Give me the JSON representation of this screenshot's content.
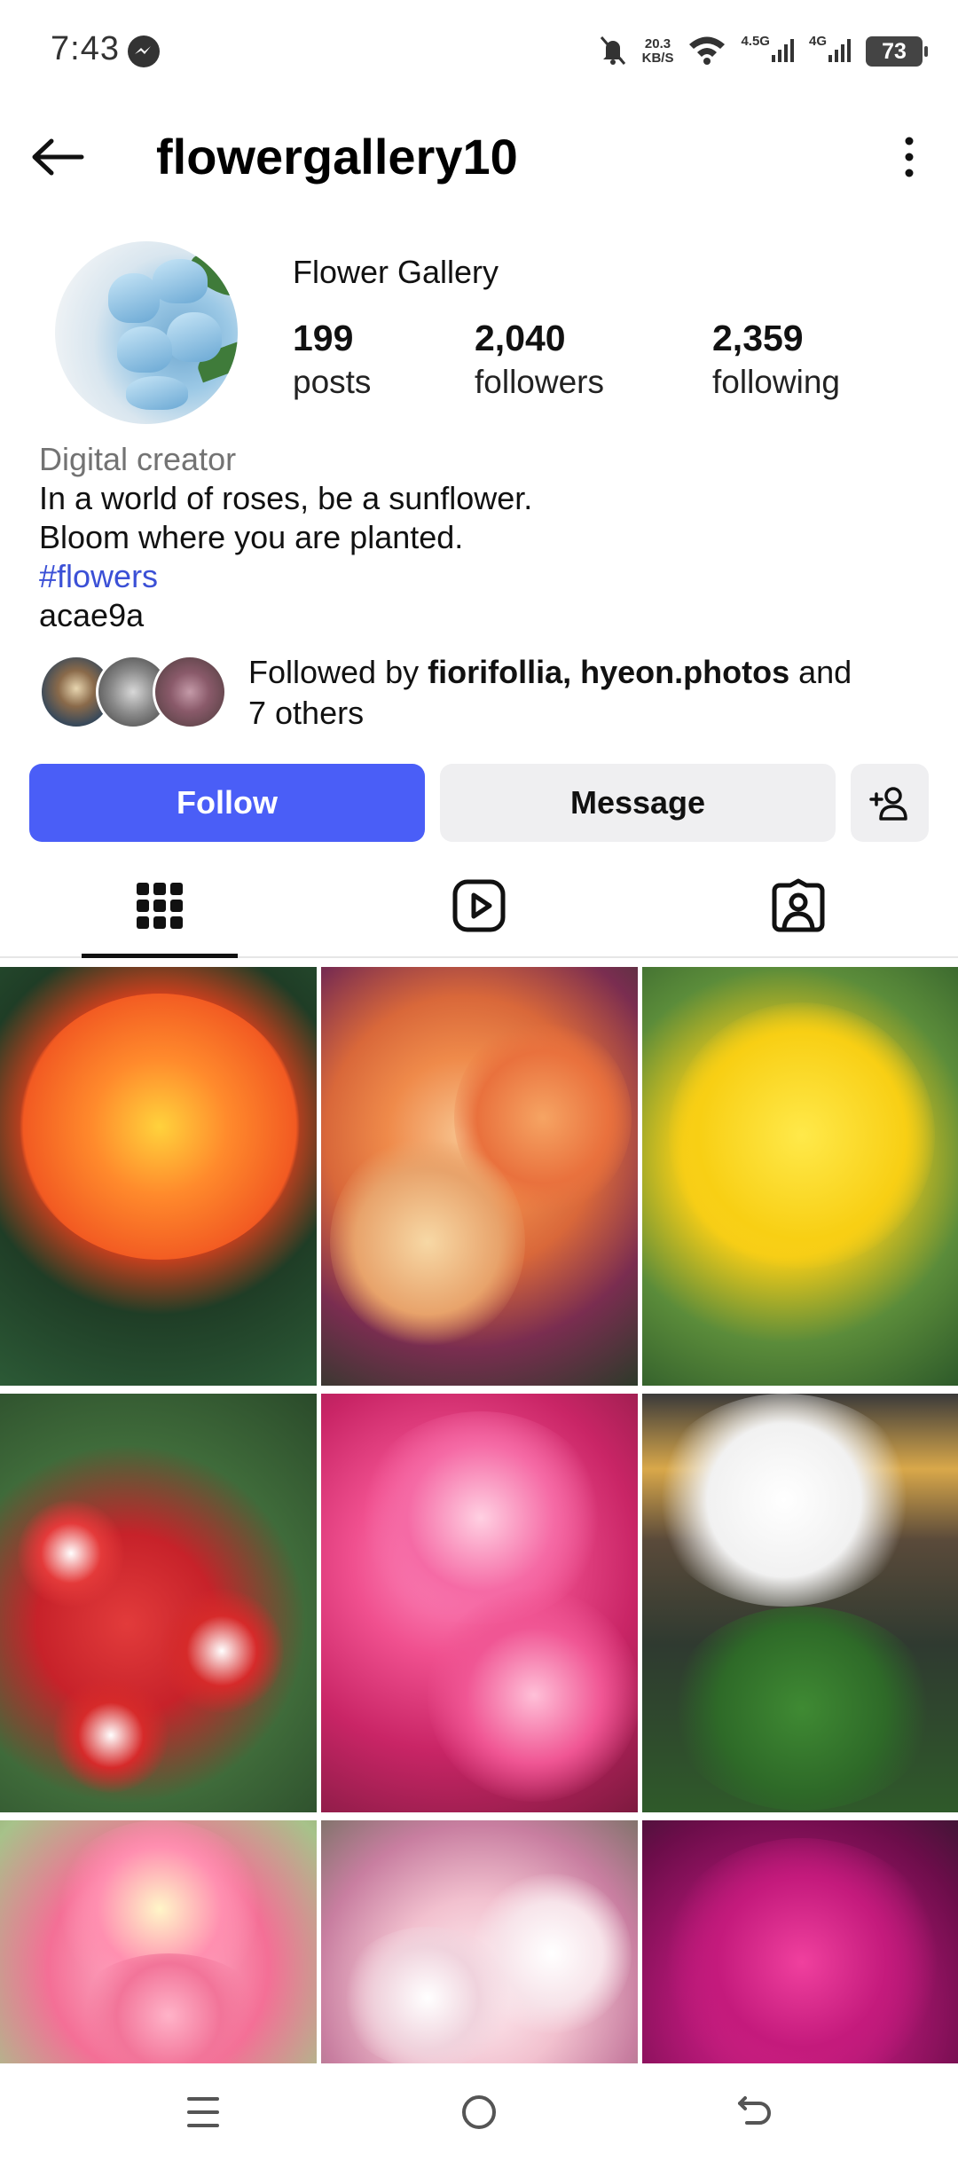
{
  "status_bar": {
    "time": "7:43",
    "net_speed_value": "20.3",
    "net_speed_unit": "KB/S",
    "signal1_label": "4.5G",
    "signal2_label": "4G",
    "battery": "73"
  },
  "header": {
    "username": "flowergallery10"
  },
  "profile": {
    "display_name": "Flower Gallery",
    "stats": {
      "posts": {
        "value": "199",
        "label": "posts"
      },
      "followers": {
        "value": "2,040",
        "label": "followers"
      },
      "following": {
        "value": "2,359",
        "label": "following"
      }
    },
    "category": "Digital creator",
    "bio_line1": "In a world of roses, be a sunflower.",
    "bio_line2": "Bloom where you are planted.",
    "hashtag": "#flowers",
    "extra_line": "acae9a",
    "followed_by": {
      "prefix": "Followed by ",
      "user1": "fiorifollia",
      "separator": ", ",
      "user2": "hyeon.photos",
      "suffix": " and",
      "others": "7 others"
    }
  },
  "buttons": {
    "follow": "Follow",
    "message": "Message"
  },
  "tabs": [
    {
      "icon": "grid-icon",
      "active": true
    },
    {
      "icon": "reels-icon",
      "active": false
    },
    {
      "icon": "tagged-icon",
      "active": false
    }
  ],
  "colors": {
    "accent": "#4a5ef7",
    "hashtag": "#3b50d6",
    "category": "#737373",
    "secondary_button": "#efeff1"
  },
  "grid_posts": 9
}
